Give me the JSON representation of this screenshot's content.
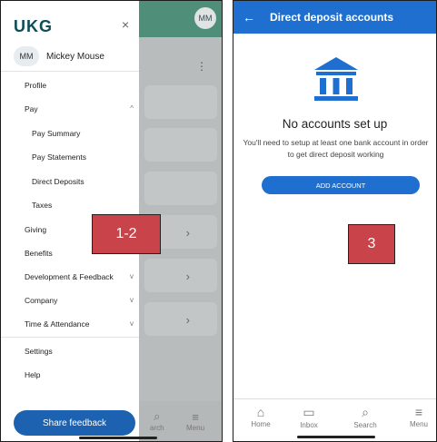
{
  "left": {
    "logo": "UKG",
    "close_label": "×",
    "user": {
      "initials": "MM",
      "name": "Mickey Mouse"
    },
    "background": {
      "avatar": "MM",
      "kebab": "⋮",
      "chevron": "›"
    },
    "menu": [
      {
        "label": "Profile"
      },
      {
        "label": "Pay",
        "chevron": "^"
      },
      {
        "label": "Pay Summary",
        "sub": true
      },
      {
        "label": "Pay Statements",
        "sub": true
      },
      {
        "label": "Direct Deposits",
        "sub": true
      },
      {
        "label": "Taxes",
        "sub": true
      },
      {
        "label": "Giving"
      },
      {
        "label": "Benefits"
      },
      {
        "label": "Development & Feedback",
        "chevron": "v"
      },
      {
        "label": "Company",
        "chevron": "v"
      },
      {
        "label": "Time & Attendance",
        "chevron": "v"
      },
      {
        "label": "Settings"
      },
      {
        "label": "Help"
      }
    ],
    "share_feedback": "Share feedback",
    "bottom_tabs": {
      "search": "arch",
      "menu": "Menu"
    },
    "callout": "1-2"
  },
  "right": {
    "header_title": "Direct deposit accounts",
    "back_icon": "←",
    "empty_title": "No accounts set up",
    "empty_desc": "You'll need to setup at least one bank account in order to get direct deposit working",
    "add_button": "ADD ACCOUNT",
    "callout": "3",
    "tabs": [
      {
        "label": "Home",
        "icon": "home-icon",
        "glyph": "⌂"
      },
      {
        "label": "Inbox",
        "icon": "inbox-icon",
        "glyph": "▭"
      },
      {
        "label": "Search",
        "icon": "search-icon",
        "glyph": "⌕"
      },
      {
        "label": "Menu",
        "icon": "menu-icon",
        "glyph": "≡"
      }
    ]
  },
  "colors": {
    "brand_blue": "#1f6fd0",
    "callout_red": "#c9444a",
    "teal_header": "#4f8f7a"
  }
}
